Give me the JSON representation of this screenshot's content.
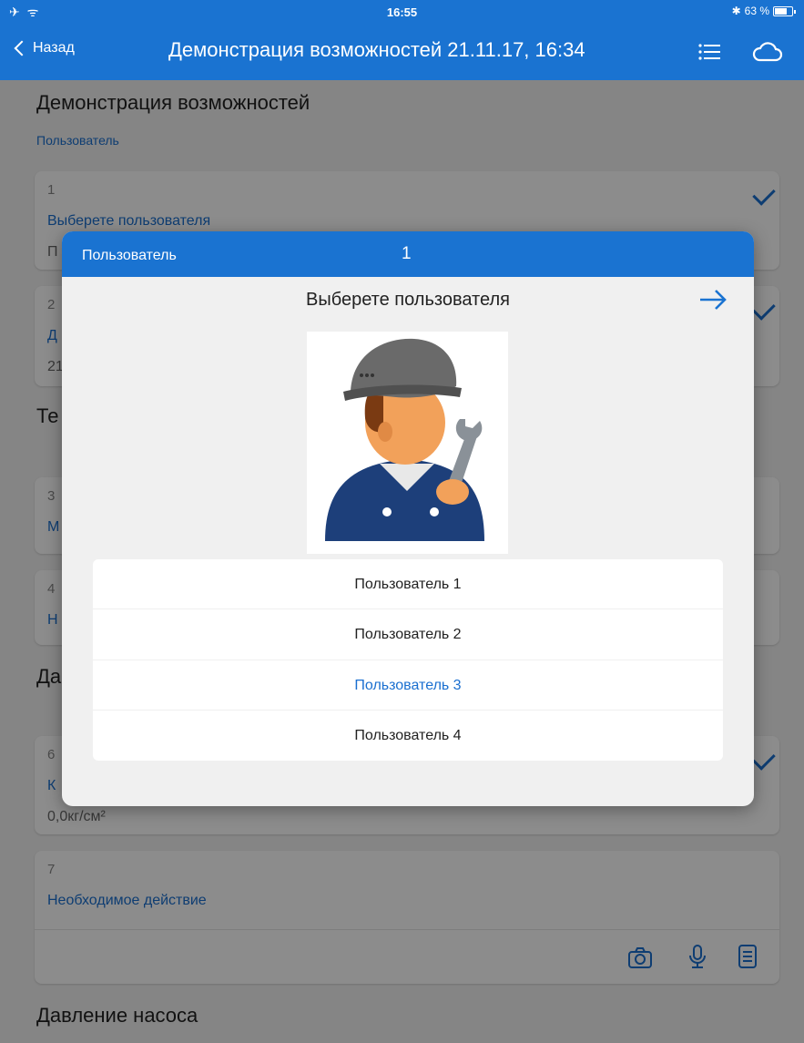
{
  "status_bar": {
    "time": "16:55",
    "battery": "63 %",
    "battery_level": 0.63
  },
  "nav": {
    "back_label": "Назад",
    "title": "Демонстрация возможностей 21.11.17, 16:34"
  },
  "form": {
    "title": "Демонстрация возможностей",
    "subtitle": "Пользователь",
    "card1": {
      "num": "1",
      "question": "Выберете пользователя",
      "value": "П"
    },
    "card2": {
      "num": "2",
      "question": "Д",
      "value": "21"
    },
    "section2": "Те",
    "card3": {
      "num": "3",
      "question": "М"
    },
    "card4": {
      "num": "4",
      "question": "Н"
    },
    "section3": "Да",
    "card6": {
      "num": "6",
      "question": "К",
      "value": "0,0кг/см²"
    },
    "card7": {
      "num": "7",
      "question": "Необходимое действие"
    },
    "section4": "Давление насоса"
  },
  "modal": {
    "header_label": "Пользователь",
    "header_number": "1",
    "question": "Выберете пользователя",
    "options": [
      "Пользователь 1",
      "Пользователь 2",
      "Пользователь 3",
      "Пользователь 4"
    ],
    "selected_index": 2
  },
  "colors": {
    "accent": "#1a73d1",
    "link": "#1a6fd0"
  },
  "icons": [
    "back-chevron-icon",
    "list-menu-icon",
    "cloud-icon",
    "arrow-right-icon",
    "camera-icon",
    "microphone-icon",
    "notes-icon",
    "checkmark-icon"
  ]
}
